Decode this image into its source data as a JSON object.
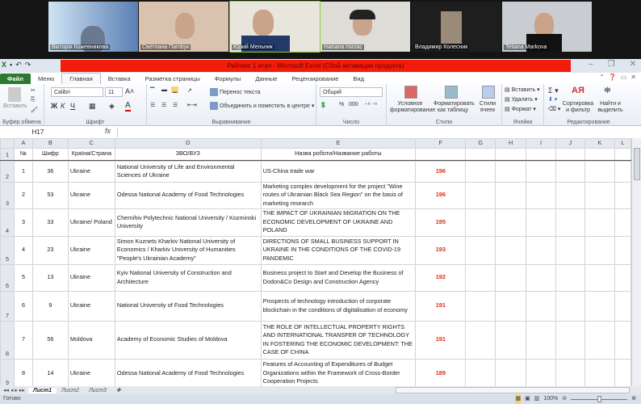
{
  "video": {
    "participants": [
      "Вікторія Кожевникова",
      "Светлана Пambук",
      "Юрий Мельник",
      "mariana mirzac",
      "Владимир Колесник",
      "Tetiana Markova"
    ]
  },
  "window": {
    "title": "Рейтинг 1 етап  -  Microsoft Excel (Сбой активации продукта)"
  },
  "tabs": [
    "Файл",
    "Меню",
    "Главная",
    "Вставка",
    "Разметка страницы",
    "Формулы",
    "Данные",
    "Рецензирование",
    "Вид"
  ],
  "ribbon": {
    "paste": "Вставить",
    "clipboard": "Буфер обмена",
    "font_name": "Calibri",
    "font_size": "11",
    "font_group": "Шрифт",
    "wrap": "Перенос текста",
    "merge": "Объединить и поместить в центре",
    "align_group": "Выравнивание",
    "number_format": "Общий",
    "percent": "%",
    "thousands": "000",
    "number_group": "Число",
    "cond_format": "Условное форматирование",
    "format_table": "Форматировать как таблицу",
    "cell_styles": "Стили ячеек",
    "styles_group": "Стили",
    "insert": "Вставить",
    "delete": "Удалить",
    "format": "Формат",
    "cells_group": "Ячейки",
    "sort": "Сортировка и фильтр",
    "find": "Найти и выделить",
    "edit_group": "Редактирование"
  },
  "formula": {
    "cell": "H17",
    "fx": "fx",
    "value": ""
  },
  "columns": [
    "A",
    "B",
    "C",
    "D",
    "E",
    "F",
    "G",
    "H",
    "I",
    "J",
    "K",
    "L"
  ],
  "header_row": {
    "num": "1",
    "cells": [
      "№",
      "Шифр",
      "Країна/Страна",
      "ЗВО/ВУЗ",
      "Назва роботи/Название работы"
    ]
  },
  "rows": [
    {
      "num": "2",
      "n": "1",
      "code": "36",
      "country": "Ukraine",
      "univ": "National University of Life and Environmental Sciences of Ukraine",
      "title": "US-China trade war",
      "score": "196"
    },
    {
      "num": "3",
      "n": "2",
      "code": "53",
      "country": "Ukraine",
      "univ": "Odessa National Academy of Food Technologies",
      "title": "Marketing complex development for the project \"Wine routes of Ukrainian Black Sea Region\" on the basis of marketing research",
      "score": "196"
    },
    {
      "num": "4",
      "n": "3",
      "code": "33",
      "country": "Ukraine/ Poland",
      "univ": "Chernihiv Polytechnic National University / Kozminski University",
      "title": "THE IMPACT OF UKRAINIAN MIGRATION ON THE ECONOMIC DEVELOPMENT OF UKRAINE AND POLAND",
      "score": "195"
    },
    {
      "num": "5",
      "n": "4",
      "code": "23",
      "country": "Ukraine",
      "univ": "Simon Kuznets Kharkiv National University of Economics / Kharkiv University of Humanities \"People's Ukrainian Academy\"",
      "title": "DIRECTIONS OF SMALL BUSINESS SUPPORT IN UKRAINE IN THE CONDITIONS OF THE COVID-19 PANDEMIC",
      "score": "193"
    },
    {
      "num": "6",
      "n": "5",
      "code": "13",
      "country": "Ukraine",
      "univ": "Kyiv National University of Construction and Architecture",
      "title": "Business project to Start and Develop the Business of Dodon&Co Design and Construction Agency",
      "score": "192"
    },
    {
      "num": "7",
      "n": "6",
      "code": "9",
      "country": "Ukraine",
      "univ": "National University of Food Technologies",
      "title": "Prospects of technology introduction of corporate blockchain in the conditions of digitalisation of economy",
      "score": "191"
    },
    {
      "num": "8",
      "n": "7",
      "code": "56",
      "country": "Moldova",
      "univ": "Academy of Economic Studies of Moldova",
      "title": "THE ROLE OF INTELLECTUAL PROPERTY RIGHTS AND INTERNATIONAL TRANSFER OF TECHNOLOGY IN FOSTERING THE ECONOMIC DEVELOPMENT: THE CASE OF CHINA",
      "score": "191"
    },
    {
      "num": "9",
      "n": "8",
      "code": "14",
      "country": "Ukraine",
      "univ": "Odessa National Academy of Food Technologies",
      "title": "Features of Accounting of Expenditures of Budget Organizations within the Framework of Cross-Border Cooperation Projects",
      "score": "189"
    }
  ],
  "sheets": [
    "Лист1",
    "Лист2",
    "Лист3"
  ],
  "status": {
    "ready": "Готово",
    "zoom": "100%"
  },
  "colors": {
    "score": "#e32a1a",
    "titlebar": "#f21c0a",
    "file_tab": "#2b7a30"
  }
}
